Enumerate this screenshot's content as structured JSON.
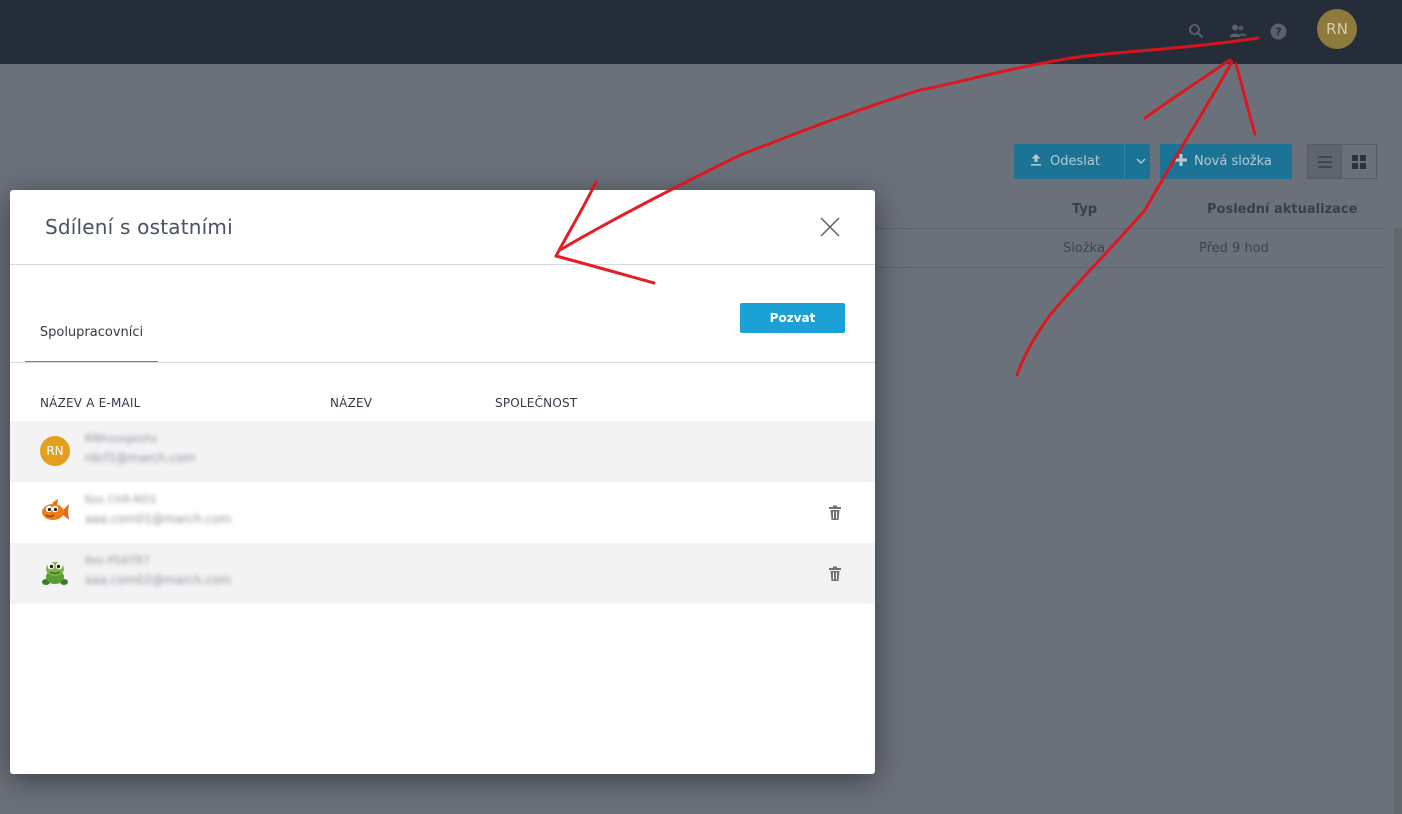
{
  "header": {
    "icons": [
      "search-icon",
      "people-icon",
      "help-icon"
    ],
    "avatar_initials": "RN"
  },
  "toolbar": {
    "upload_label": "Odeslat",
    "new_folder_label": "Nová složka"
  },
  "file_table": {
    "columns": [
      "Typ",
      "Poslední aktualizace"
    ],
    "rows": [
      {
        "type": "Složka",
        "updated": "Před 9 hod"
      }
    ]
  },
  "modal": {
    "title": "Sdílení s ostatními",
    "tab_label": "Spolupracovníci",
    "invite_label": "Pozvat",
    "columns": [
      "NÁZEV A E-MAIL",
      "NÁZEV",
      "SPOLEČNOST"
    ],
    "users": [
      {
        "avatar": "RN",
        "name": "RNhsssgeshs",
        "email": "rdcf1@march.com"
      },
      {
        "avatar": "fish-avatar-icon",
        "name": "Kes ChR-RD1",
        "email": "aaa.com01@march.com"
      },
      {
        "avatar": "turtle-avatar-icon",
        "name": "Kes PS4TR7",
        "email": "aaa.com02@march.com"
      }
    ]
  },
  "colors": {
    "accent": "#1ba1d6",
    "topbar": "#262d3a",
    "annotation": "#e0141a"
  }
}
